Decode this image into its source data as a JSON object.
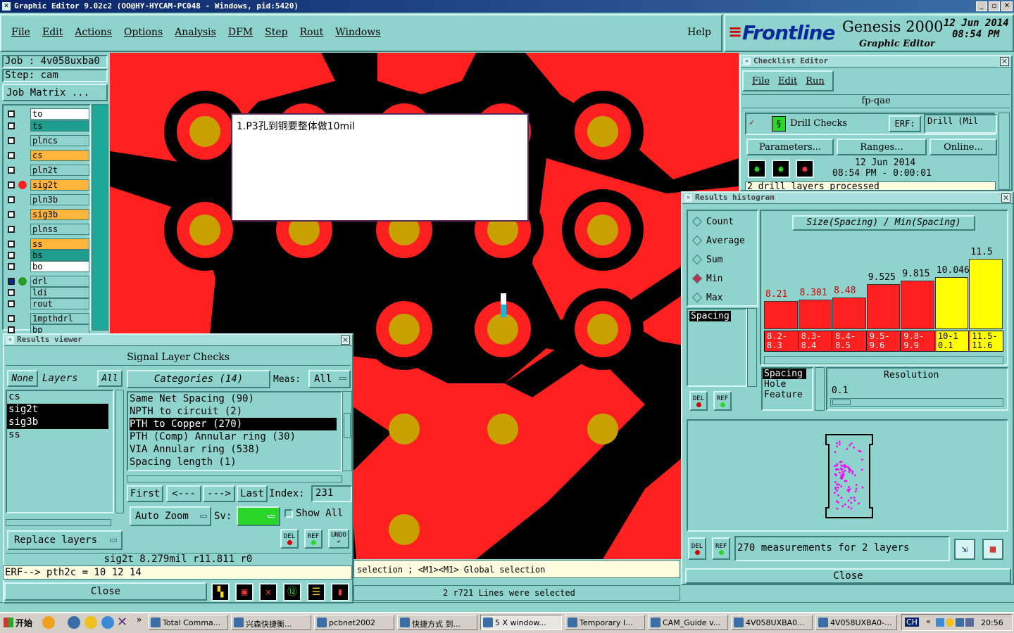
{
  "window": {
    "title": "Graphic Editor 9.02c2 (OO@HY-HYCAM-PC048 - Windows, pid:5420)"
  },
  "menu": {
    "items": [
      "File",
      "Edit",
      "Actions",
      "Options",
      "Analysis",
      "DFM",
      "Step",
      "Rout",
      "Windows"
    ],
    "help": "Help"
  },
  "brand": {
    "logo": "Frontline",
    "product": "Genesis 2000",
    "subtitle": "Graphic Editor",
    "date": "12 Jun 2014",
    "time": "08:54 PM"
  },
  "job": {
    "job_label": "Job : 4v058uxba0",
    "step_label": "Step: cam",
    "matrix_button": "Job Matrix ..."
  },
  "layers": [
    {
      "name": "to",
      "color": "#ffffff"
    },
    {
      "name": "ts",
      "color": "#1e9e8e"
    },
    {
      "name": "plncs",
      "color": "#8fd3cd"
    },
    {
      "name": "cs",
      "color": "#ffb43c"
    },
    {
      "name": "pln2t",
      "color": "#8fd3cd"
    },
    {
      "name": "sig2t",
      "color": "#ffb43c",
      "active": true
    },
    {
      "name": "pln3b",
      "color": "#8fd3cd"
    },
    {
      "name": "sig3b",
      "color": "#ffb43c"
    },
    {
      "name": "plnss",
      "color": "#8fd3cd"
    },
    {
      "name": "ss",
      "color": "#ffb43c"
    },
    {
      "name": "bs",
      "color": "#1e9e8e"
    },
    {
      "name": "bo",
      "color": "#ffffff"
    },
    {
      "name": "drl",
      "color": "#8fd3cd",
      "selected": true
    },
    {
      "name": "ldi",
      "color": "#8fd3cd"
    },
    {
      "name": "rout",
      "color": "#8fd3cd"
    },
    {
      "name": "1mpthdrl",
      "color": "#8fd3cd"
    },
    {
      "name": "bp",
      "color": "#8fd3cd"
    }
  ],
  "canvas": {
    "note": "1.P3孔到铜要整体做10mil",
    "status_selection": "selection ; <M1><M1> Global selection",
    "status_lines": "2 r721 Lines were selected"
  },
  "checklist": {
    "title": "Checklist Editor",
    "menu": [
      "File",
      "Edit",
      "Run"
    ],
    "name": "fp-qae",
    "check_name": "Drill Checks",
    "erf_label": "ERF:",
    "erf_value": "Drill (Mil",
    "buttons": [
      "Parameters...",
      "Ranges...",
      "Online..."
    ],
    "run_date": "12 Jun 2014",
    "run_time": "08:54 PM - 0:00:01",
    "message": "2 drill layers processed"
  },
  "histogram": {
    "title": "Results histogram",
    "modes": [
      "Count",
      "Average",
      "Sum",
      "Min",
      "Max"
    ],
    "selected_mode": "Min",
    "chart_title": "Size(Spacing) / Min(Spacing)",
    "list_items": [
      "Spacing"
    ],
    "meas_types": [
      "Spacing",
      "Hole",
      "Feature"
    ],
    "resolution_label": "Resolution",
    "resolution_value": "0.1",
    "summary": "270 measurements for 2 layers",
    "del": "DEL",
    "ref": "REF",
    "close": "Close"
  },
  "chart_data": {
    "type": "bar",
    "title": "Size(Spacing) / Min(Spacing)",
    "categories": [
      "8.2-8.3",
      "8.3-8.4",
      "8.4-8.5",
      "9.5-9.6",
      "9.8-9.9",
      "10-10.1",
      "11.5-11.6"
    ],
    "values": [
      8.21,
      8.301,
      8.48,
      9.525,
      9.815,
      10.046,
      11.5
    ],
    "value_labels": [
      "8.21",
      "8.301",
      "8.48",
      "9.525",
      "9.815",
      "10.046",
      "11.5"
    ],
    "colors": [
      "#ff2020",
      "#ff2020",
      "#ff2020",
      "#ff2020",
      "#ff2020",
      "#ffff00",
      "#ffff00"
    ],
    "ylim": [
      6,
      11.6
    ]
  },
  "results": {
    "title": "Results viewer",
    "header": "Signal Layer Checks",
    "none": "None",
    "layers_label": "Layers",
    "all": "All",
    "layer_list": [
      "cs",
      "sig2t",
      "sig3b",
      "ss"
    ],
    "selected_layers": [
      "sig2t",
      "sig3b"
    ],
    "categories_label": "Categories (14)",
    "meas_label": "Meas:",
    "meas_value": "All",
    "categories": [
      "Same Net Spacing (90)",
      "NPTH to circuit (2)",
      "PTH to Copper (270)",
      "PTH (Comp) Annular ring (30)",
      "VIA Annular ring (538)",
      "Spacing length (1)"
    ],
    "selected_category": "PTH to Copper (270)",
    "nav": {
      "first": "First",
      "prev": "<---",
      "next": "--->",
      "last": "Last",
      "index_label": "Index:",
      "index_value": "231"
    },
    "auto_zoom": "Auto Zoom",
    "sv": "Sv:",
    "show_all": "Show All",
    "replace_layers": "Replace layers",
    "del": "DEL",
    "ref": "REF",
    "undo": "UNDO",
    "info": "sig2t 8.279mil  r11.811  r0",
    "erf": "ERF--> pth2c = 10 12 14",
    "close": "Close"
  },
  "taskbar": {
    "start": "开始",
    "items": [
      "Total Comma...",
      "兴森快捷衡...",
      "pcbnet2002",
      "快捷方式 到...",
      "5 X window...",
      "Temporary I...",
      "CAM_Guide v...",
      "4V058UXBA0...",
      "4V058UXBA0-..."
    ],
    "lang": "CH",
    "clock": "20:56"
  }
}
